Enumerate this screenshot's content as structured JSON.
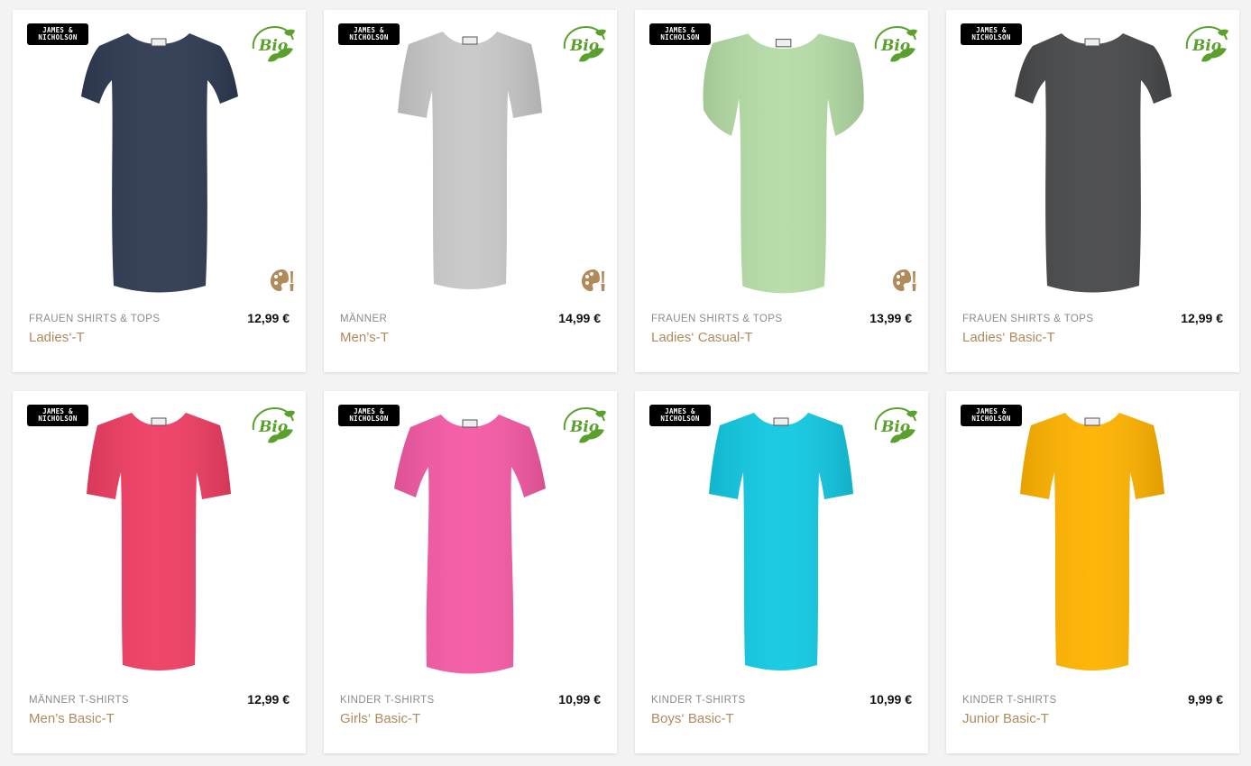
{
  "brand": {
    "line1": "JAMES &",
    "line2": "NICHOLSON"
  },
  "bio_label": "Bio",
  "colors": {
    "name_link": "#b08a5a",
    "category": "#8a8a8a",
    "bio_green": "#5aa02c",
    "art_icon": "#b08a5a"
  },
  "products": [
    {
      "category": "FRAUEN SHIRTS & TOPS",
      "name": "Ladies‘-T",
      "price": "12,99 €",
      "color": "#2f3a52",
      "style": "ladies",
      "bio": true,
      "art_icon": true
    },
    {
      "category": "MÄNNER",
      "name": "Men’s-T",
      "price": "14,99 €",
      "color": "#c8c8c8",
      "style": "mens",
      "bio": true,
      "art_icon": true
    },
    {
      "category": "FRAUEN SHIRTS & TOPS",
      "name": "Ladies‘ Casual-T",
      "price": "13,99 €",
      "color": "#b5dca6",
      "style": "casual",
      "bio": true,
      "art_icon": true
    },
    {
      "category": "FRAUEN SHIRTS & TOPS",
      "name": "Ladies‘ Basic-T",
      "price": "12,99 €",
      "color": "#48494b",
      "style": "ladies",
      "bio": true,
      "art_icon": false
    },
    {
      "category": "MÄNNER T-SHIRTS",
      "name": "Men’s Basic-T",
      "price": "12,99 €",
      "color": "#ef3e63",
      "style": "mens",
      "bio": true,
      "art_icon": false
    },
    {
      "category": "KINDER T-SHIRTS",
      "name": "Girls‘ Basic-T",
      "price": "10,99 €",
      "color": "#f55aa5",
      "style": "girls",
      "bio": true,
      "art_icon": false
    },
    {
      "category": "KINDER T-SHIRTS",
      "name": "Boys‘ Basic-T",
      "price": "10,99 €",
      "color": "#12c9e2",
      "style": "mens",
      "bio": true,
      "art_icon": false
    },
    {
      "category": "KINDER T-SHIRTS",
      "name": "Junior Basic-T",
      "price": "9,99 €",
      "color": "#ffb300",
      "style": "mens",
      "bio": false,
      "art_icon": false
    }
  ]
}
